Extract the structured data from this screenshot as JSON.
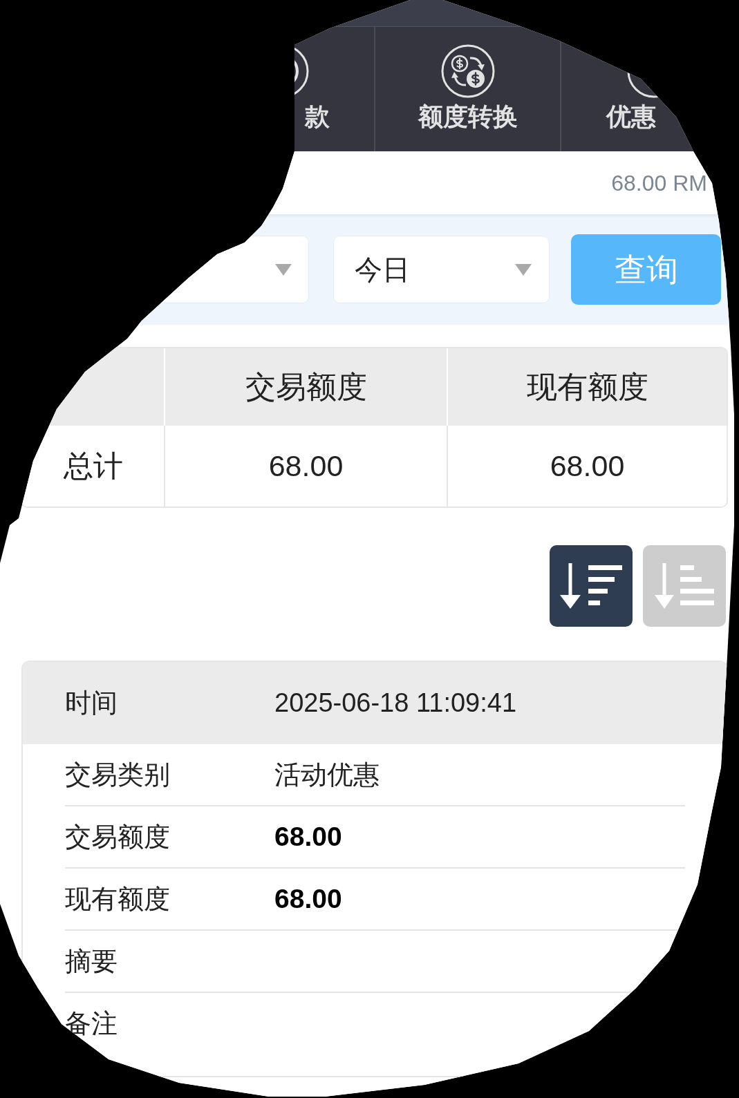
{
  "nav": [
    {
      "label": "款"
    },
    {
      "label": "额度转换"
    },
    {
      "label": "优惠"
    }
  ],
  "balance_bar": {
    "text": "68.00 RM"
  },
  "filters": {
    "selects": [
      {
        "kind": "dropdown"
      },
      {
        "kind": "dropdown",
        "value": "今日"
      }
    ],
    "button": "查询"
  },
  "summary_table": {
    "columns": [
      "交易额度",
      "现有额度"
    ],
    "rows": [
      {
        "label": "总计",
        "cells": [
          "68.00",
          "68.00"
        ]
      }
    ]
  },
  "sort_buttons": [
    {
      "selected": true
    },
    {
      "selected": false
    }
  ],
  "detail": {
    "header": {
      "label": "时间",
      "value": "2025-06-18 11:09:41"
    },
    "rows": [
      {
        "label": "交易类别",
        "value": "活动优惠",
        "strong": false
      },
      {
        "label": "交易额度",
        "value": "68.00",
        "strong": true
      },
      {
        "label": "现有额度",
        "value": "68.00",
        "strong": true
      },
      {
        "label": "摘要"
      },
      {
        "label": "备注"
      }
    ]
  }
}
